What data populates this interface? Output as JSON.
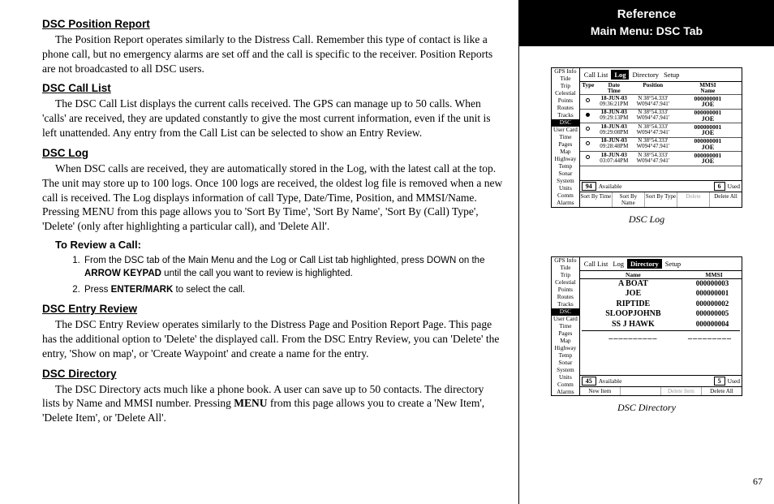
{
  "header": {
    "ref": "Reference",
    "sub": "Main Menu: DSC Tab"
  },
  "page_number": "67",
  "sections": {
    "s1_head": "DSC Position Report",
    "s1_body": "The Position Report operates similarly to the Distress Call. Remember this type of contact is like a phone call, but no emergency alarms are set off and the call is specific to the receiver. Position Reports are not broadcasted to all DSC users.",
    "s2_head": "DSC Call List",
    "s2_body": "The DSC Call List displays the current calls received. The GPS can manage up to 50 calls. When 'calls' are received, they are updated constantly to give the most current information, even if the unit is left unattended. Any entry from the Call List can be selected to show an Entry Review.",
    "s3_head": "DSC Log",
    "s3_body": "When DSC calls are received, they are automatically stored in the Log, with the latest call at the top. The unit may store up to 100 logs. Once 100 logs are received, the oldest log file is removed when a new call is received. The Log displays information of call Type, Date/Time, Position, and MMSI/Name. Pressing MENU from this page allows you to 'Sort By Time', 'Sort By Name', 'Sort By (Call) Type', 'Delete' (only after highlighting a particular call), and 'Delete All'.",
    "s3_sub": "To Review a Call:",
    "s3_step1a": "From the DSC tab of the Main Menu and the Log or Call List tab highlighted, press DOWN on the ",
    "s3_step1b": "ARROW KEYPAD",
    "s3_step1c": " until the call you want to review is highlighted.",
    "s3_step2a": "Press ",
    "s3_step2b": "ENTER/MARK",
    "s3_step2c": " to select the call.",
    "s4_head": "DSC Entry Review",
    "s4_body": "The DSC Entry Review operates similarly to the Distress Page and Position Report Page. This page has the additional option to 'Delete' the displayed call. From the DSC Entry Review, you can 'Delete' the entry, 'Show on map', or 'Create Waypoint' and create a name for the entry.",
    "s5_head": "DSC Directory",
    "s5_body_a": "The DSC Directory acts much like a phone book. A user can save up to 50 contacts. The directory lists by Name and MMSI number. Pressing ",
    "s5_body_b": "MENU",
    "s5_body_c": " from this page allows you to create a 'New Item', 'Delete Item', or 'Delete All'."
  },
  "fig1": {
    "caption": "DSC Log",
    "sidebar": [
      "GPS Info",
      "Tide",
      "Trip",
      "Celestial",
      "Points",
      "Routes",
      "Tracks",
      "DSC",
      "User Card",
      "Time",
      "Pages",
      "Map",
      "Highway",
      "Temp",
      "Sonar",
      "System",
      "Units",
      "Comm",
      "Alarms"
    ],
    "active_side": "DSC",
    "tabs": [
      "Call List",
      "Log",
      "Directory",
      "Setup"
    ],
    "active_tab": "Log",
    "cols": {
      "type": "Type",
      "date": "Date\nTime",
      "pos": "Position",
      "mmsi": "MMSI\nName"
    },
    "rows": [
      {
        "dot": "open",
        "date": "18-JUN-03",
        "time": "09:36:21PM",
        "lat": "N 38°54.333'",
        "lon": "W094°47.941'",
        "mmsi": "000000001",
        "name": "JOE"
      },
      {
        "dot": "filled",
        "date": "18-JUN-03",
        "time": "09:29:13PM",
        "lat": "N 38°54.333'",
        "lon": "W094°47.941'",
        "mmsi": "000000001",
        "name": "JOE"
      },
      {
        "dot": "open",
        "date": "18-JUN-03",
        "time": "09:29:08PM",
        "lat": "N 38°54.333'",
        "lon": "W094°47.941'",
        "mmsi": "000000001",
        "name": "JOE"
      },
      {
        "dot": "open",
        "date": "18-JUN-03",
        "time": "09:28:48PM",
        "lat": "N 38°54.333'",
        "lon": "W094°47.941'",
        "mmsi": "000000001",
        "name": "JOE"
      },
      {
        "dot": "open",
        "date": "18-JUN-03",
        "time": "03:07:44PM",
        "lat": "N 38°54.333'",
        "lon": "W094°47.941'",
        "mmsi": "000000001",
        "name": "JOE"
      }
    ],
    "status": {
      "avail_n": "94",
      "avail_l": "Available",
      "used_n": "6",
      "used_l": "Used"
    },
    "bottom": [
      "Sort By Time",
      "Sort By Name",
      "Sort By Type",
      "Delete",
      "Delete All"
    ]
  },
  "fig2": {
    "caption": "DSC Directory",
    "sidebar": [
      "GPS Info",
      "Tide",
      "Trip",
      "Celestial",
      "Points",
      "Routes",
      "Tracks",
      "DSC",
      "User Card",
      "Time",
      "Pages",
      "Map",
      "Highway",
      "Temp",
      "Sonar",
      "System",
      "Units",
      "Comm",
      "Alarms"
    ],
    "active_side": "DSC",
    "tabs": [
      "Call List",
      "Log",
      "Directory",
      "Setup"
    ],
    "active_tab": "Directory",
    "cols": {
      "name": "Name",
      "mmsi": "MMSI"
    },
    "rows": [
      {
        "name": "A BOAT",
        "mmsi": "000000003"
      },
      {
        "name": "JOE",
        "mmsi": "000000001"
      },
      {
        "name": "RIPTIDE",
        "mmsi": "000000002"
      },
      {
        "name": "SLOOPJOHNB",
        "mmsi": "000000005"
      },
      {
        "name": "SS J HAWK",
        "mmsi": "000000004"
      }
    ],
    "dashes": {
      "n": "__________",
      "m": "_________"
    },
    "status": {
      "avail_n": "45",
      "avail_l": "Available",
      "used_n": "5",
      "used_l": "Used"
    },
    "bottom": [
      "New Item",
      "",
      "Delete Item",
      "Delete All"
    ]
  }
}
